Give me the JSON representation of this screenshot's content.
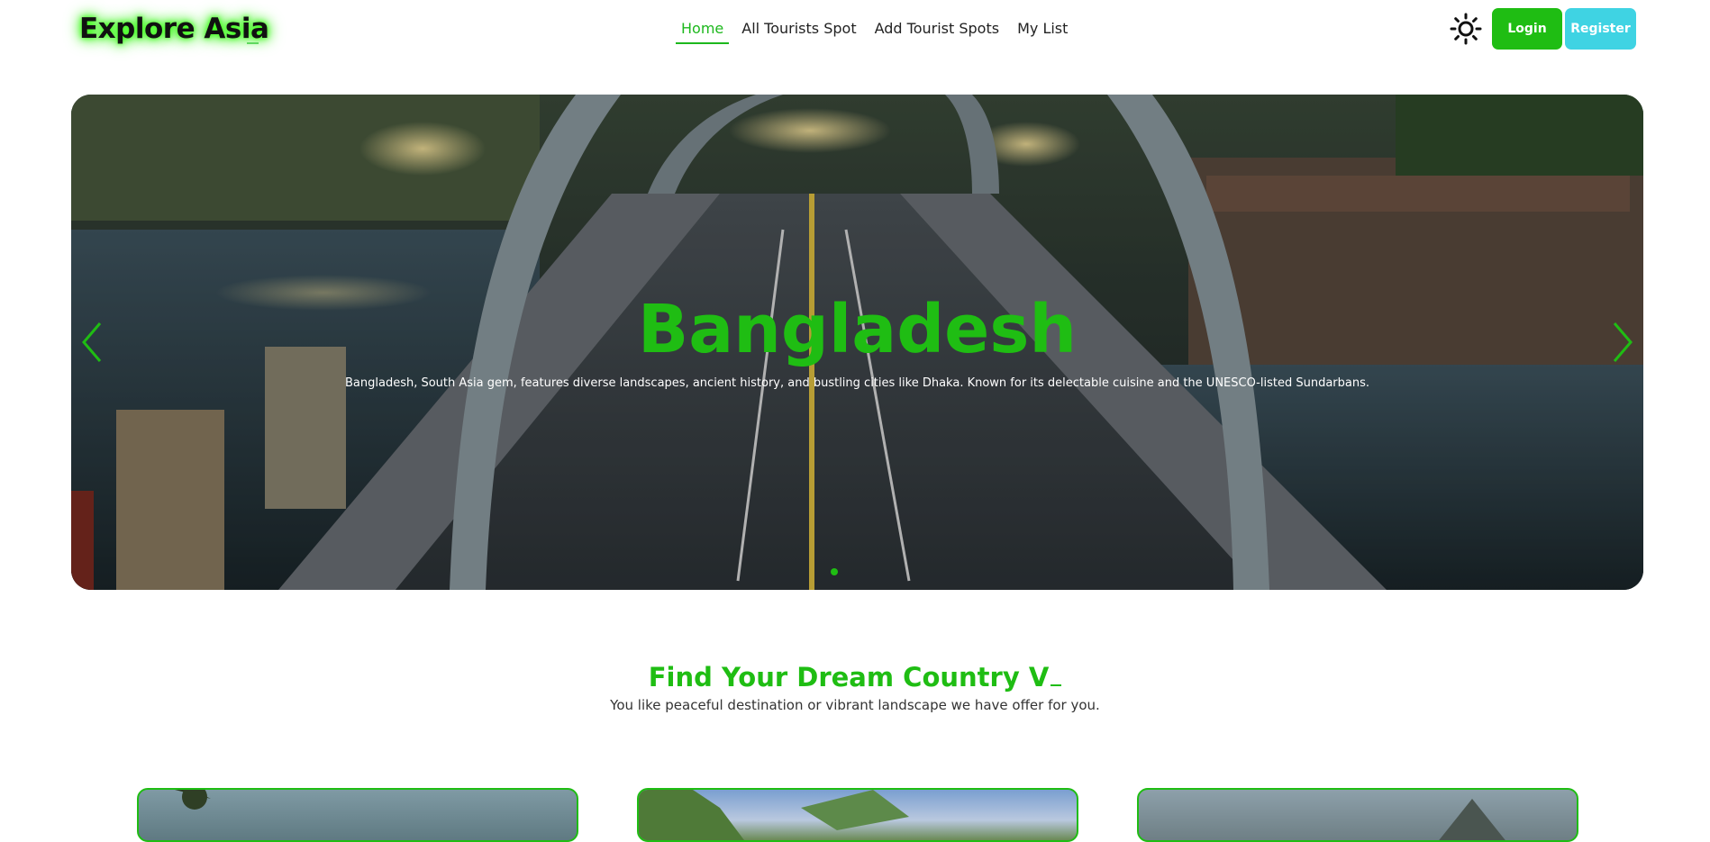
{
  "brand": {
    "logo_text": "Explore Asia"
  },
  "nav": {
    "links": [
      {
        "label": "Home",
        "active": true
      },
      {
        "label": "All Tourists Spot",
        "active": false
      },
      {
        "label": "Add Tourist Spots",
        "active": false
      },
      {
        "label": "My List",
        "active": false
      }
    ],
    "theme_icon": "sun-icon",
    "login_label": "Login",
    "register_label": "Register"
  },
  "hero": {
    "title": "Bangladesh",
    "description": "Bangladesh, South Asia gem, features diverse landscapes, ancient history, and bustling cities like Dhaka. Known for its delectable cuisine and the UNESCO-listed Sundarbans.",
    "prev_icon": "chevron-left-icon",
    "next_icon": "chevron-right-icon",
    "active_slide": 1
  },
  "section": {
    "title": "Find Your Dream Country V",
    "subtitle": "You like peaceful destination or vibrant landscape we have offer for you."
  },
  "colors": {
    "accent_green": "#1fbd13",
    "register_cyan": "#3fd3e3",
    "logo_glow": "#39ff14"
  }
}
